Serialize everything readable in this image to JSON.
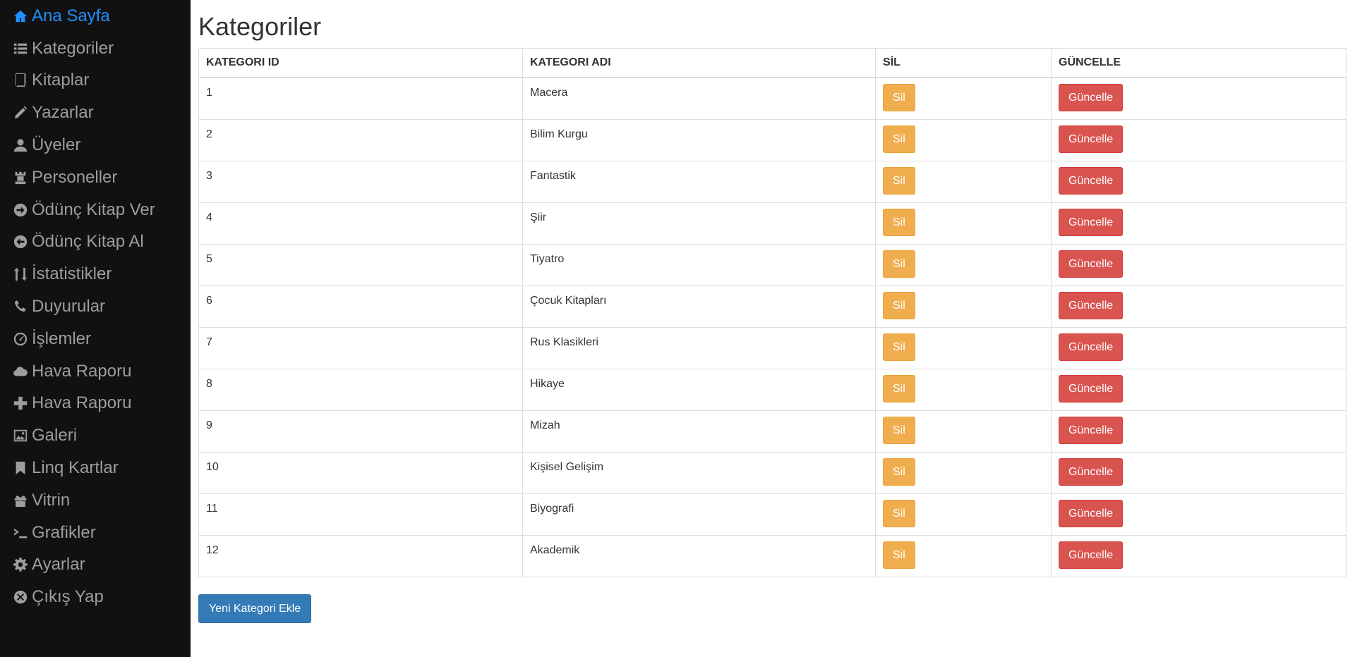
{
  "sidebar": {
    "items": [
      {
        "label": "Ana Sayfa",
        "icon": "home-icon",
        "active": true
      },
      {
        "label": "Kategoriler",
        "icon": "list-icon"
      },
      {
        "label": "Kitaplar",
        "icon": "book-icon"
      },
      {
        "label": "Yazarlar",
        "icon": "pencil-icon"
      },
      {
        "label": "Üyeler",
        "icon": "user-icon"
      },
      {
        "label": "Personeller",
        "icon": "tower-icon"
      },
      {
        "label": "Ödünç Kitap Ver",
        "icon": "arrow-right-circle-icon"
      },
      {
        "label": "Ödünç Kitap Al",
        "icon": "arrow-left-circle-icon"
      },
      {
        "label": "İstatistikler",
        "icon": "sort-icon"
      },
      {
        "label": "Duyurular",
        "icon": "phone-icon"
      },
      {
        "label": "İşlemler",
        "icon": "dashboard-icon"
      },
      {
        "label": "Hava Raporu",
        "icon": "cloud-icon"
      },
      {
        "label": "Hava Raporu",
        "icon": "plus-icon"
      },
      {
        "label": "Galeri",
        "icon": "picture-icon"
      },
      {
        "label": "Linq Kartlar",
        "icon": "bookmark-icon"
      },
      {
        "label": "Vitrin",
        "icon": "gift-icon"
      },
      {
        "label": "Grafikler",
        "icon": "console-icon"
      },
      {
        "label": "Ayarlar",
        "icon": "cog-icon"
      },
      {
        "label": "Çıkış Yap",
        "icon": "remove-circle-icon"
      }
    ]
  },
  "main": {
    "title": "Kategoriler",
    "table": {
      "headers": [
        "KATEGORI ID",
        "KATEGORI ADI",
        "SİL",
        "GÜNCELLE"
      ],
      "rows": [
        {
          "id": "1",
          "name": "Macera"
        },
        {
          "id": "2",
          "name": "Bilim Kurgu"
        },
        {
          "id": "3",
          "name": "Fantastik"
        },
        {
          "id": "4",
          "name": "Şiir"
        },
        {
          "id": "5",
          "name": "Tiyatro"
        },
        {
          "id": "6",
          "name": "Çocuk Kitapları"
        },
        {
          "id": "7",
          "name": "Rus Klasikleri"
        },
        {
          "id": "8",
          "name": "Hikaye"
        },
        {
          "id": "9",
          "name": "Mizah"
        },
        {
          "id": "10",
          "name": "Kişisel Gelişim"
        },
        {
          "id": "11",
          "name": "Biyografi"
        },
        {
          "id": "12",
          "name": "Akademik"
        }
      ],
      "delete_label": "Sil",
      "update_label": "Güncelle"
    },
    "add_button_label": "Yeni Kategori Ekle"
  },
  "colors": {
    "sidebar_bg": "#111111",
    "nav_text": "#9d9d9d",
    "nav_active": "#1e90ff",
    "warning": "#f0ad4e",
    "danger": "#d9534f",
    "primary": "#337ab7"
  }
}
